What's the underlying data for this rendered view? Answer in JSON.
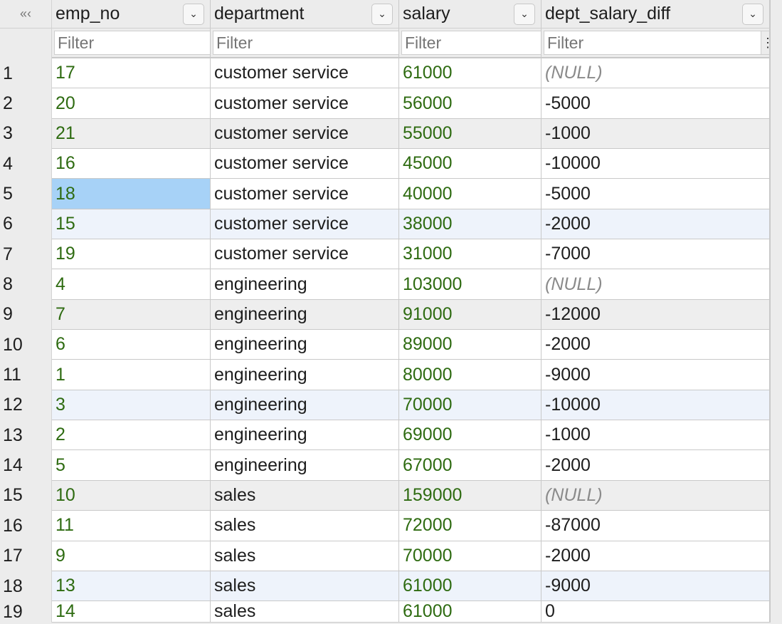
{
  "collapse_glyph": "«‹",
  "columns": [
    {
      "name": "emp_no",
      "filter_placeholder": "Filter"
    },
    {
      "name": "department",
      "filter_placeholder": "Filter"
    },
    {
      "name": "salary",
      "filter_placeholder": "Filter"
    },
    {
      "name": "dept_salary_diff",
      "filter_placeholder": "Filter"
    }
  ],
  "rows": [
    {
      "n": "1",
      "emp_no": "17",
      "department": "customer service",
      "salary": "61000",
      "diff": "(NULL)"
    },
    {
      "n": "2",
      "emp_no": "20",
      "department": "customer service",
      "salary": "56000",
      "diff": "-5000"
    },
    {
      "n": "3",
      "emp_no": "21",
      "department": "customer service",
      "salary": "55000",
      "diff": "-1000"
    },
    {
      "n": "4",
      "emp_no": "16",
      "department": "customer service",
      "salary": "45000",
      "diff": "-10000"
    },
    {
      "n": "5",
      "emp_no": "18",
      "department": "customer service",
      "salary": "40000",
      "diff": "-5000"
    },
    {
      "n": "6",
      "emp_no": "15",
      "department": "customer service",
      "salary": "38000",
      "diff": "-2000"
    },
    {
      "n": "7",
      "emp_no": "19",
      "department": "customer service",
      "salary": "31000",
      "diff": "-7000"
    },
    {
      "n": "8",
      "emp_no": "4",
      "department": "engineering",
      "salary": "103000",
      "diff": "(NULL)"
    },
    {
      "n": "9",
      "emp_no": "7",
      "department": "engineering",
      "salary": "91000",
      "diff": "-12000"
    },
    {
      "n": "10",
      "emp_no": "6",
      "department": "engineering",
      "salary": "89000",
      "diff": "-2000"
    },
    {
      "n": "11",
      "emp_no": "1",
      "department": "engineering",
      "salary": "80000",
      "diff": "-9000"
    },
    {
      "n": "12",
      "emp_no": "3",
      "department": "engineering",
      "salary": "70000",
      "diff": "-10000"
    },
    {
      "n": "13",
      "emp_no": "2",
      "department": "engineering",
      "salary": "69000",
      "diff": "-1000"
    },
    {
      "n": "14",
      "emp_no": "5",
      "department": "engineering",
      "salary": "67000",
      "diff": "-2000"
    },
    {
      "n": "15",
      "emp_no": "10",
      "department": "sales",
      "salary": "159000",
      "diff": "(NULL)"
    },
    {
      "n": "16",
      "emp_no": "11",
      "department": "sales",
      "salary": "72000",
      "diff": "-87000"
    },
    {
      "n": "17",
      "emp_no": "9",
      "department": "sales",
      "salary": "70000",
      "diff": "-2000"
    },
    {
      "n": "18",
      "emp_no": "13",
      "department": "sales",
      "salary": "61000",
      "diff": "-9000"
    },
    {
      "n": "19",
      "emp_no": "14",
      "department": "sales",
      "salary": "61000",
      "diff": "0"
    }
  ],
  "selected_cell": {
    "row": "5",
    "column": "emp_no"
  },
  "colors": {
    "number_text": "#2e6b11",
    "null_text": "#8a8a8a",
    "selection": "#a7d2f7"
  }
}
